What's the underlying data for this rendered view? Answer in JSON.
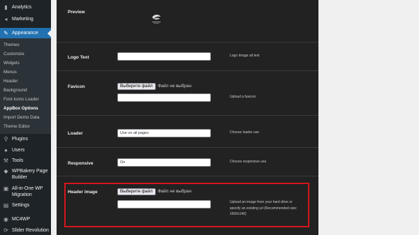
{
  "sidebar": {
    "top_items": [
      {
        "label": "Analytics",
        "icon": "analytics-icon"
      },
      {
        "label": "Marketing",
        "icon": "megaphone-icon"
      }
    ],
    "active_item": {
      "label": "Appearance",
      "icon": "paintbrush-icon"
    },
    "submenu": [
      "Themes",
      "Customize",
      "Widgets",
      "Menus",
      "Header",
      "Background",
      "Font Icons Loader",
      "AppBox Options",
      "Import Demo Data",
      "Theme Editor"
    ],
    "current_submenu": "AppBox Options",
    "bottom_items": [
      {
        "label": "Plugins",
        "icon": "plugin-icon"
      },
      {
        "label": "Users",
        "icon": "users-icon"
      },
      {
        "label": "Tools",
        "icon": "wrench-icon"
      },
      {
        "label": "WPBakery Page Builder",
        "icon": "wpbakery-icon"
      },
      {
        "label": "All-in-One WP Migration",
        "icon": "migration-icon"
      },
      {
        "label": "Settings",
        "icon": "settings-icon"
      },
      {
        "label": "MC4WP",
        "icon": "mc4wp-icon"
      },
      {
        "label": "Slider Revolution",
        "icon": "slider-icon"
      }
    ]
  },
  "options": {
    "preview": {
      "label": "Preview"
    },
    "logo_text": {
      "label": "Logo Text",
      "value": "",
      "description": "Logo Image alt text"
    },
    "favicon": {
      "label": "Favicon",
      "button": "Выберите файл",
      "status": "Файл не выбран",
      "value": "",
      "description": "Upload a favicon."
    },
    "loader": {
      "label": "Loader",
      "value": "Use on all pages",
      "description": "Choose loader use"
    },
    "responsive": {
      "label": "Responsive",
      "value": "On",
      "description": "Choose responsive use"
    },
    "header_image": {
      "label": "Header image",
      "button": "Выберите файл",
      "status": "Файл не выбран",
      "value": "",
      "description_lines": [
        "Upload an image from your hard drive or",
        "specify an existing url (Recommended size:",
        "1600x140)"
      ]
    }
  },
  "colors": {
    "sidebar_bg": "#1d2327",
    "active_menu": "#2271b1",
    "panel_bg": "#222222",
    "highlight": "#d6151c"
  }
}
